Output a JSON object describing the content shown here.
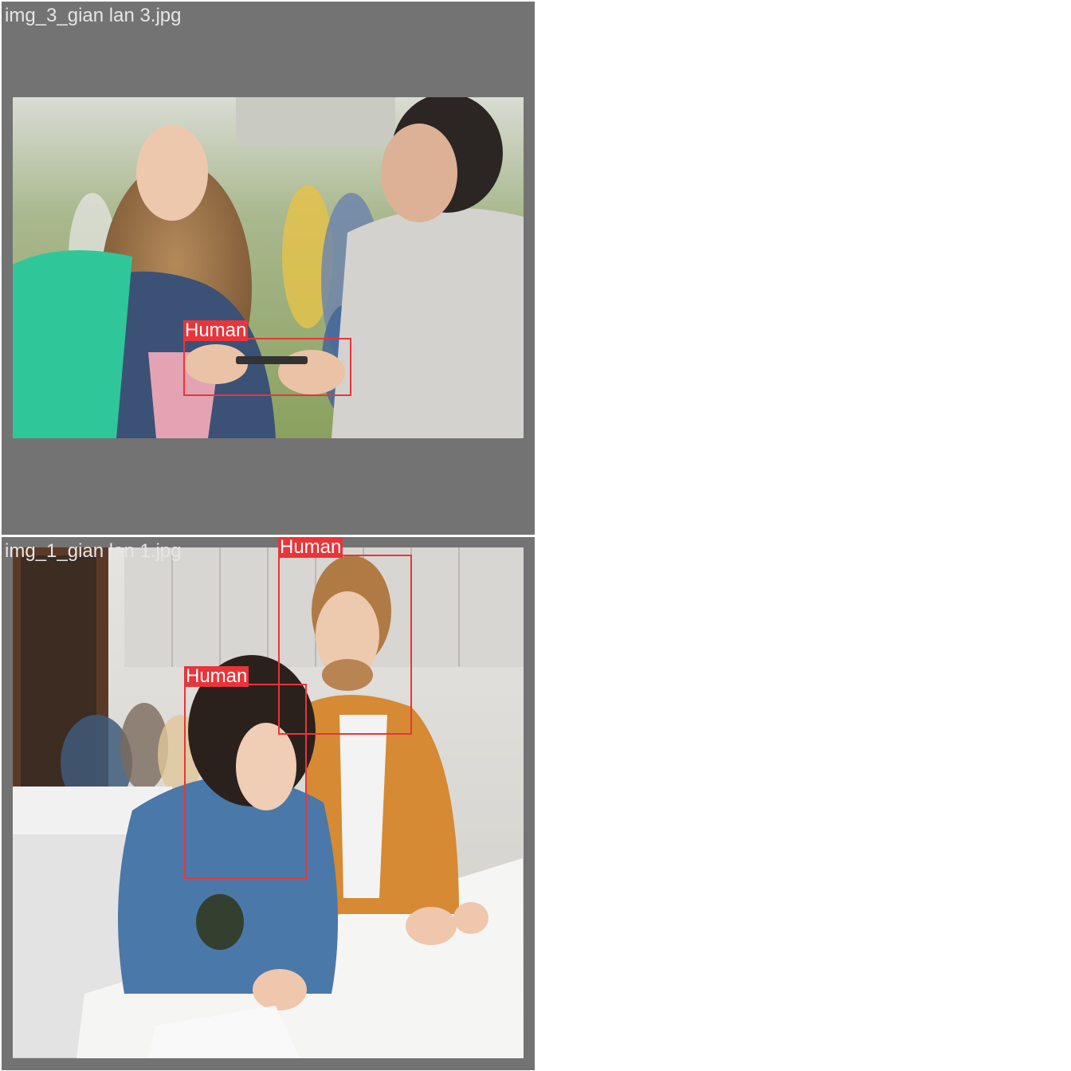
{
  "tiles": [
    {
      "filename": "img_3_gian lan 3.jpg",
      "detections": [
        {
          "label": "Human"
        }
      ]
    },
    {
      "filename": "img_1_gian lan 1.jpg",
      "detections": [
        {
          "label": "Human"
        },
        {
          "label": "Human"
        }
      ]
    }
  ],
  "colors": {
    "tile_background": "#737373",
    "detection_box": "#e8353a",
    "label_text": "#ffffff",
    "filename_text": "#e6e6e6"
  }
}
